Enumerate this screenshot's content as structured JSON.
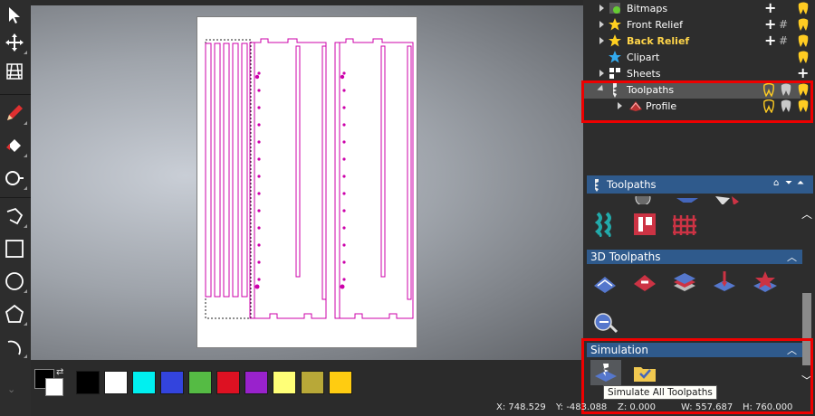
{
  "tree": {
    "items": [
      {
        "label": "Bitmaps",
        "style": "normal"
      },
      {
        "label": "Front Relief",
        "style": "normal"
      },
      {
        "label": "Back Relief",
        "style": "bold-yellow"
      },
      {
        "label": "Clipart",
        "style": "normal"
      },
      {
        "label": "Sheets",
        "style": "normal"
      },
      {
        "label": "Toolpaths",
        "style": "selected"
      },
      {
        "label": "Profile",
        "style": "child"
      }
    ]
  },
  "panels": {
    "toolpaths_title": "Toolpaths",
    "toolpaths_3d_title": "3D Toolpaths",
    "simulation_title": "Simulation"
  },
  "tooltip": {
    "text": "Simulate All Toolpaths"
  },
  "status": {
    "x": "X: 748.529",
    "y": "Y: -483.088",
    "z": "Z: 0.000",
    "w": "W: 557.687",
    "h": "H: 760.000"
  },
  "colors": {
    "accent": "#2f5a8c",
    "highlight_box": "#ee0000",
    "vector": "#cc00aa",
    "swatches": [
      "#000000",
      "#ffffff",
      "#00f0f0",
      "#3344dd",
      "#55bb44",
      "#dd1122",
      "#9922cc",
      "#ffff77",
      "#b8a838",
      "#ffcc11"
    ]
  },
  "icons": {
    "left_toolbar": [
      "select-arrow-icon",
      "transform-icon",
      "node-edit-icon",
      "pencil-icon",
      "fill-bucket-icon",
      "measure-icon",
      "polyline-icon",
      "rectangle-icon",
      "circle-icon",
      "polygon-icon",
      "arc-icon"
    ]
  }
}
